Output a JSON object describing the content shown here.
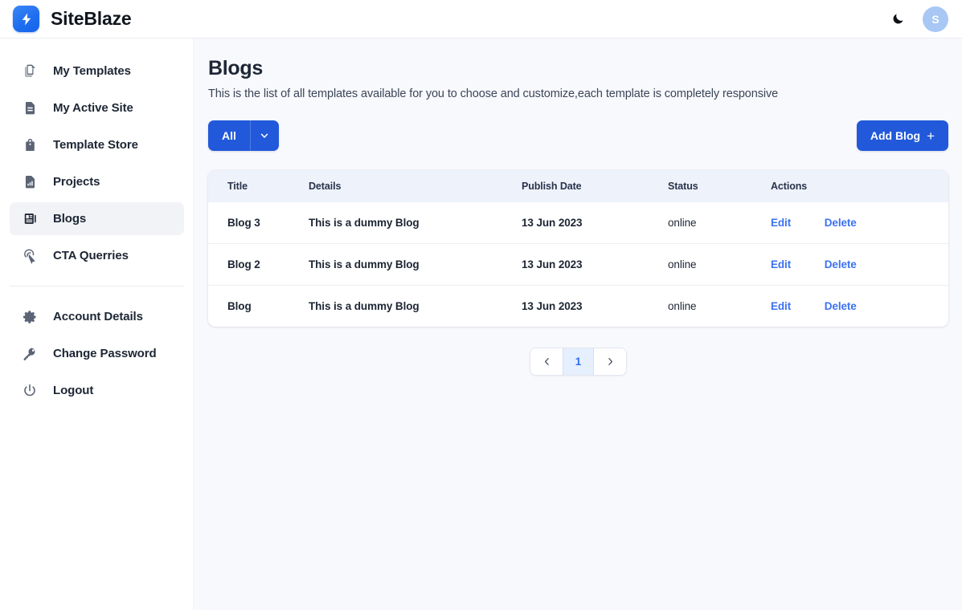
{
  "brand": {
    "name": "SiteBlaze",
    "logo_icon": "lightning-bolt-icon",
    "logo_color": "#1f6ef0"
  },
  "topbar": {
    "theme_toggle_icon": "moon-icon",
    "avatar_initial": "S",
    "avatar_color": "#a8c7f5"
  },
  "sidebar": {
    "items": [
      {
        "label": "My Templates",
        "icon": "templates-copy-icon",
        "active": false
      },
      {
        "label": "My Active Site",
        "icon": "document-icon",
        "active": false
      },
      {
        "label": "Template Store",
        "icon": "shopping-bag-icon",
        "active": false
      },
      {
        "label": "Projects",
        "icon": "chart-document-icon",
        "active": false
      },
      {
        "label": "Blogs",
        "icon": "blog-layout-icon",
        "active": true
      },
      {
        "label": "CTA Querries",
        "icon": "cursor-click-icon",
        "active": false
      }
    ],
    "footer_items": [
      {
        "label": "Account Details",
        "icon": "gear-icon"
      },
      {
        "label": "Change Password",
        "icon": "key-icon"
      },
      {
        "label": "Logout",
        "icon": "power-icon"
      }
    ]
  },
  "page": {
    "title": "Blogs",
    "subtitle": "This is the list of all templates available for you to choose and customize,each template is completely responsive"
  },
  "toolbar": {
    "filter_label": "All",
    "filter_caret_icon": "chevron-down-icon",
    "add_label": "Add Blog",
    "add_plus_icon": "plus-icon",
    "accent_color": "#2159da"
  },
  "table": {
    "columns": [
      "Title",
      "Details",
      "Publish Date",
      "Status",
      "Actions"
    ],
    "rows": [
      {
        "title": "Blog 3",
        "details": "This is a dummy Blog",
        "publish_date": "13 Jun 2023",
        "status": "online",
        "edit_label": "Edit",
        "delete_label": "Delete"
      },
      {
        "title": "Blog 2",
        "details": "This is a dummy Blog",
        "publish_date": "13 Jun 2023",
        "status": "online",
        "edit_label": "Edit",
        "delete_label": "Delete"
      },
      {
        "title": "Blog",
        "details": "This is a dummy Blog",
        "publish_date": "13 Jun 2023",
        "status": "online",
        "edit_label": "Edit",
        "delete_label": "Delete"
      }
    ]
  },
  "pagination": {
    "prev_icon": "chevron-left-icon",
    "next_icon": "chevron-right-icon",
    "current_page": "1",
    "active_color": "#2f6cf0"
  }
}
